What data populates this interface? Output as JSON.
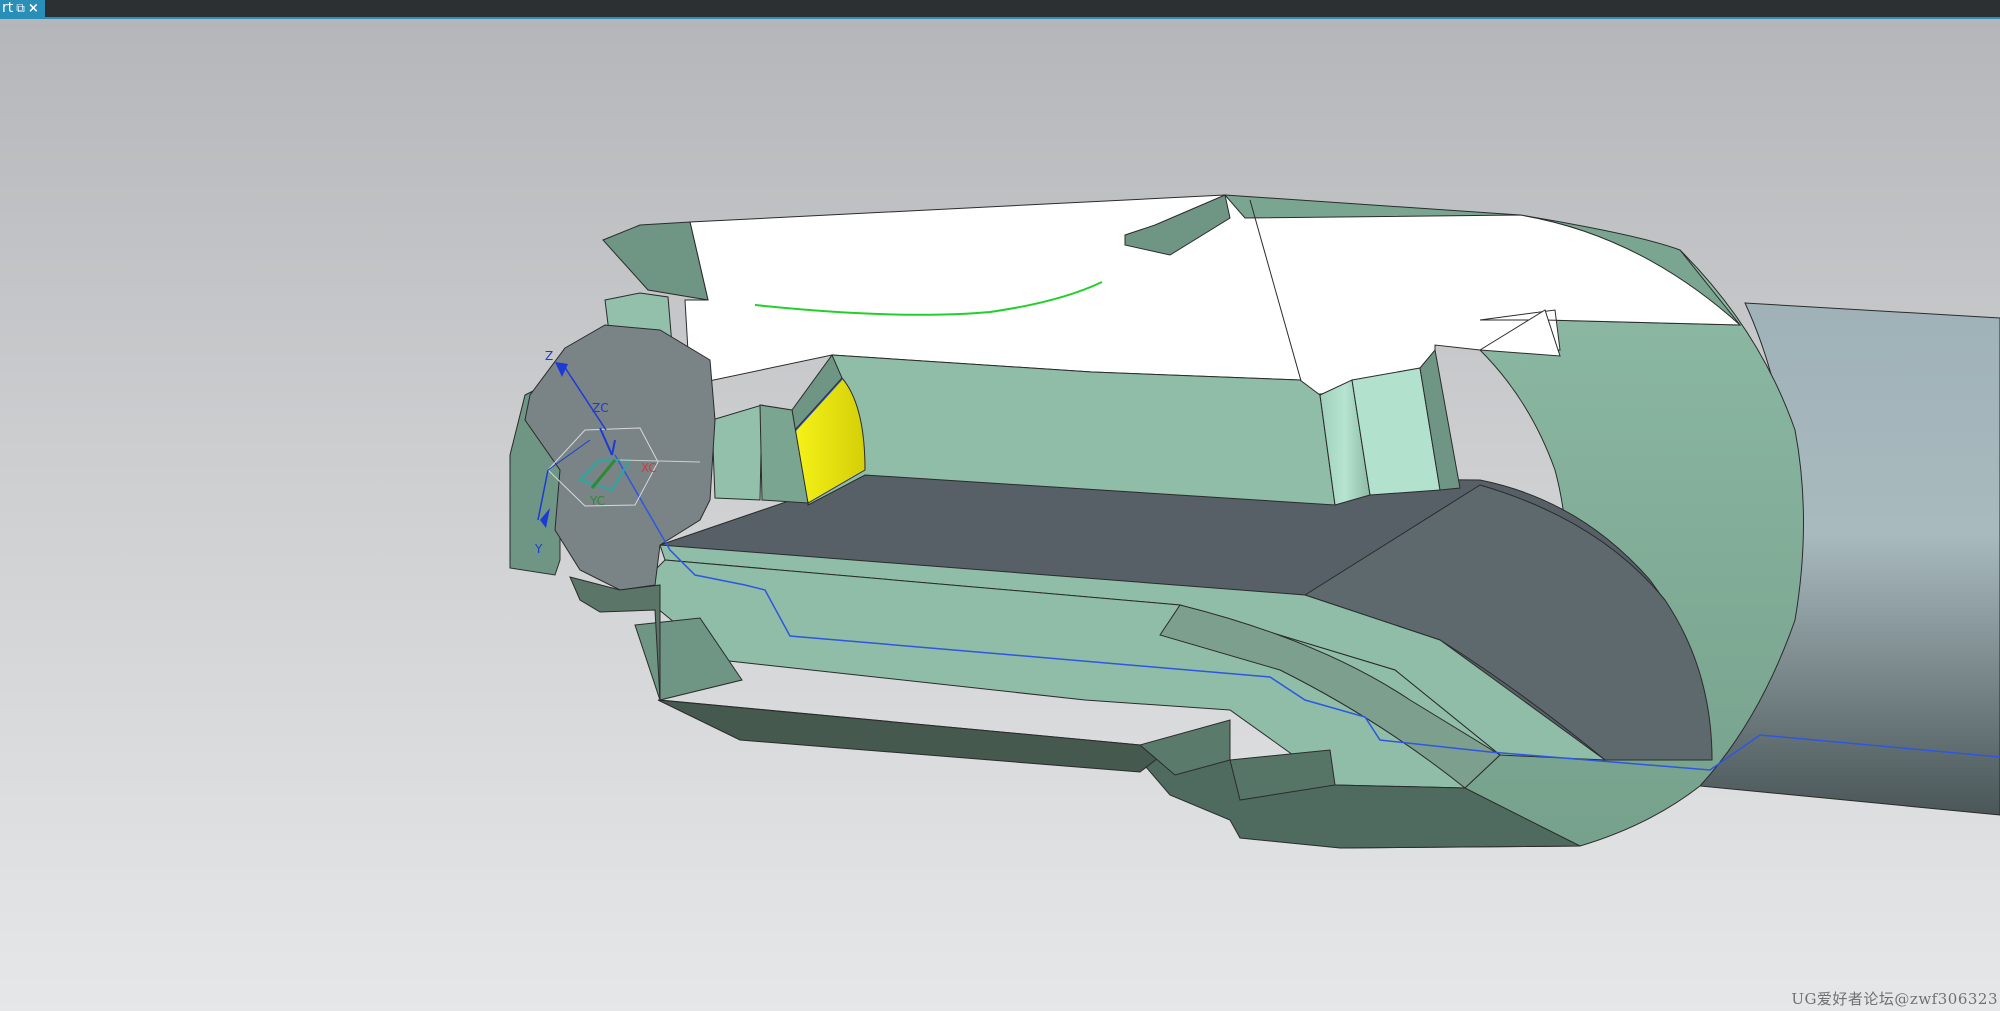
{
  "window": {
    "tab_label": "rt",
    "tab_icon": "restore-window-icon",
    "tab_close": "×"
  },
  "viewport": {
    "axes": {
      "z": "Z",
      "zc": "ZC",
      "xc": "XC",
      "yc": "YC",
      "y": "Y"
    },
    "watermark": "UG爱好者论坛@zwf306323"
  },
  "colors": {
    "tab_accent": "#2a8fb8",
    "part_face_light": "#8fbda7",
    "part_face_mid": "#7aa691",
    "part_face_dark": "#4f6b5f",
    "section_face": "#ffffff",
    "bore_dark": "#566066",
    "shaft": "#a6b6ba",
    "highlight_face": "#f0ec12",
    "toolpath": "#2f56e0",
    "sketch_curve": "#22d02a"
  }
}
